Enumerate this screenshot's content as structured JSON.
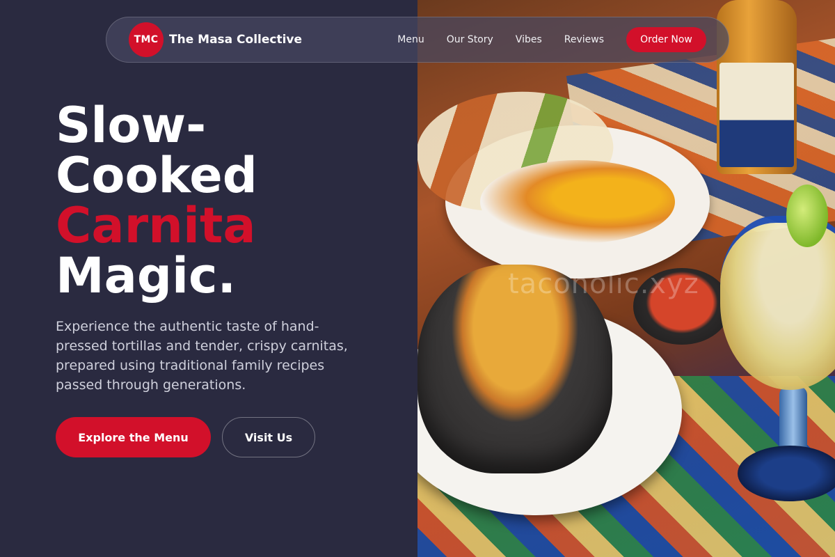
{
  "brand": {
    "badge": "TMC",
    "name": "The Masa Collective"
  },
  "nav": {
    "links": [
      "Menu",
      "Our Story",
      "Vibes",
      "Reviews"
    ],
    "cta": "Order Now"
  },
  "hero": {
    "title_line1": "Slow-",
    "title_line2": "Cooked",
    "title_accent": "Carnita",
    "title_line4": "Magic.",
    "description": "Experience the authentic taste of hand-pressed tortillas and tender, crispy carnitas, prepared using traditional family recipes passed through generations.",
    "primary_button": "Explore the Menu",
    "secondary_button": "Visit Us"
  },
  "image": {
    "watermark": "taconolic.xyz"
  },
  "colors": {
    "background": "#2a2a40",
    "accent": "#d2102a",
    "text": "#ffffff",
    "muted_text": "#cfd0dc"
  }
}
